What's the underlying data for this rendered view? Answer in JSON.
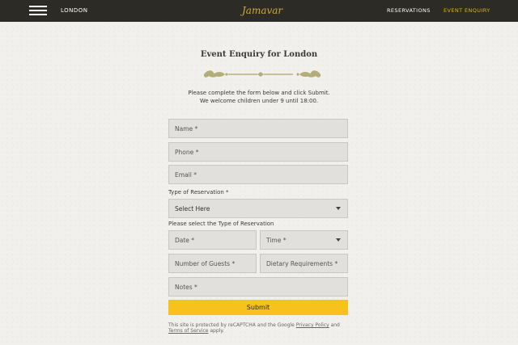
{
  "header": {
    "location": "LONDON",
    "logo_text": "Jamavar",
    "nav": {
      "reservations": "RESERVATIONS",
      "event_enquiry": "EVENT ENQUIRY"
    }
  },
  "page": {
    "title": "Event Enquiry for London",
    "intro_line1": "Please complete the form below and click Submit.",
    "intro_line2": "We welcome children under 9 until 18:00."
  },
  "form": {
    "name_placeholder": "Name *",
    "phone_placeholder": "Phone *",
    "email_placeholder": "Email *",
    "reservation_type_label": "Type of Reservation *",
    "reservation_type_value": "Select Here",
    "reservation_type_hint": "Please select the Type of Reservation",
    "date_placeholder": "Date *",
    "time_placeholder": "Time *",
    "guests_placeholder": "Number of Guests *",
    "dietary_placeholder": "Dietary Requirements *",
    "notes_placeholder": "Notes *",
    "submit_label": "Submit"
  },
  "recaptcha": {
    "text_before": "This site is protected by reCAPTCHA and the Google ",
    "privacy_link": "Privacy Policy",
    "and_text": " and ",
    "terms_link": "Terms of Service",
    "text_after": " apply."
  },
  "colors": {
    "topbar": "#2c2b26",
    "accent_gold": "#e2b320",
    "submit_yellow": "#f7c21b",
    "ornament": "#b3ad7a"
  },
  "icons": {
    "menu": "hamburger-icon",
    "dropdown": "caret-down-icon",
    "divider": "ornament-divider"
  }
}
